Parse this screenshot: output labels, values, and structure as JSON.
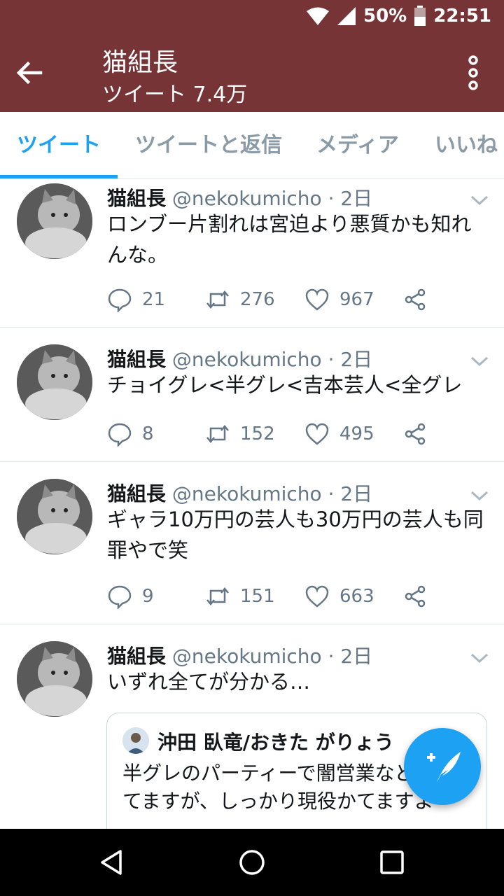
{
  "status_bar": {
    "battery": "50%",
    "time": "22:51"
  },
  "app_bar": {
    "title": "猫組長",
    "subtitle": "ツイート 7.4万",
    "back_icon": "arrow-left-icon",
    "more_icon": "more-vertical-icon"
  },
  "tabs": [
    {
      "label": "ツイート",
      "active": true
    },
    {
      "label": "ツイートと返信",
      "active": false
    },
    {
      "label": "メディア",
      "active": false
    },
    {
      "label": "いいね",
      "active": false
    }
  ],
  "tweets": [
    {
      "name": "猫組長",
      "handle": "@nekokumicho · 2日",
      "text": "ロンブー片割れは宮迫より悪質かも知れんな。",
      "replies": "21",
      "retweets": "276",
      "likes": "967"
    },
    {
      "name": "猫組長",
      "handle": "@nekokumicho · 2日",
      "text": "チョイグレ<半グレ<吉本芸人<全グレ",
      "replies": "8",
      "retweets": "152",
      "likes": "495"
    },
    {
      "name": "猫組長",
      "handle": "@nekokumicho · 2日",
      "text": "ギャラ10万円の芸人も30万円の芸人も同罪やで笑",
      "replies": "9",
      "retweets": "151",
      "likes": "663"
    },
    {
      "name": "猫組長",
      "handle": "@nekokumicho · 2日",
      "text": "いずれ全てが分かる…",
      "quote": {
        "name": "沖田 臥竜/おきた がりょう",
        "text": "半グレのパーティーで闇営業など言われてますが、しっかり現役かてますよ"
      }
    }
  ],
  "colors": {
    "brand_bar": "#773436",
    "accent": "#1da1f2",
    "muted": "#657786"
  },
  "fab": {
    "icon": "compose-tweet-icon"
  },
  "navigation": {
    "icons": [
      "back-triangle-icon",
      "home-circle-icon",
      "recents-square-icon"
    ]
  }
}
